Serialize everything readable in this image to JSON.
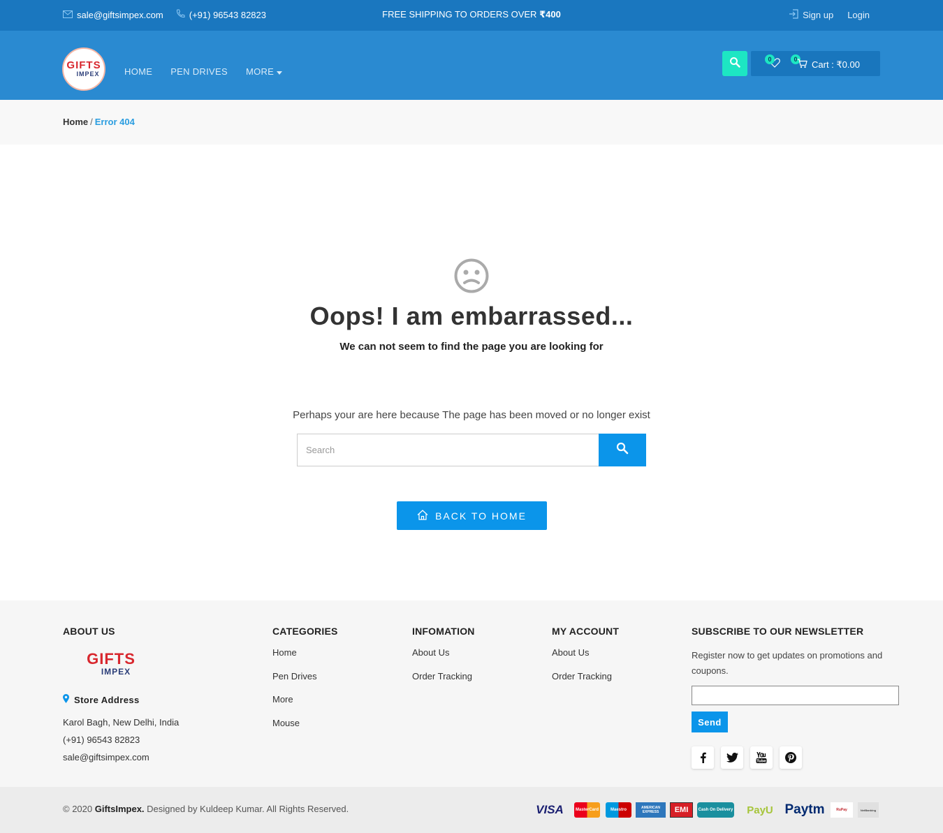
{
  "topbar": {
    "email": "sale@giftsimpex.com",
    "phone": "(+91) 96543 82823",
    "promo_text": "FREE SHIPPING TO ORDERS OVER",
    "promo_amount": "₹400",
    "signup_label": "Sign up",
    "login_label": "Login"
  },
  "header": {
    "logo_line1": "GIFTS",
    "logo_line2": "IMPEX",
    "nav": [
      "HOME",
      "PEN DRIVES",
      "MORE"
    ],
    "wishlist_count": "0",
    "cart_count": "0",
    "cart_label": "Cart : ₹0.00"
  },
  "breadcrumb": {
    "home": "Home",
    "separator": "/",
    "current": "Error 404"
  },
  "main": {
    "title": "Oops! I am embarrassed...",
    "subtitle": "We can not seem to find the page you are looking for",
    "reason": "Perhaps your are here because The page has been moved or no longer exist",
    "search_placeholder": "Search",
    "back_label": "BACK TO HOME"
  },
  "footer": {
    "about": {
      "heading": "ABOUT US",
      "logo_line1": "GIFTS",
      "logo_line2": "IMPEX",
      "store_heading": "Store Address",
      "address": "Karol Bagh, New Delhi, India",
      "phone": "(+91) 96543 82823",
      "email": "sale@giftsimpex.com"
    },
    "categories": {
      "heading": "CATEGORIES",
      "items": [
        "Home",
        "Pen Drives",
        "More",
        "Mouse"
      ]
    },
    "information": {
      "heading": "INFOMATION",
      "items": [
        "About Us",
        "Order Tracking"
      ]
    },
    "account": {
      "heading": "MY ACCOUNT",
      "items": [
        "About Us",
        "Order Tracking"
      ]
    },
    "newsletter": {
      "heading": "SUBSCRIBE TO OUR NEWSLETTER",
      "text": "Register now to get updates on promotions and coupons.",
      "send_label": "Send",
      "socials": [
        "facebook-icon",
        "twitter-icon",
        "youtube-icon",
        "pinterest-icon"
      ]
    }
  },
  "bottom": {
    "copyright_prefix": "© 2020",
    "brand": "GiftsImpex.",
    "copyright_suffix": "Designed by Kuldeep Kumar. All Rights Reserved.",
    "payments": [
      "VISA",
      "MasterCard",
      "Maestro",
      "AMERICAN EXPRESS",
      "EMI",
      "Cash On Delivery",
      "PayU",
      "Paytm",
      "RuPay",
      "NetBanking"
    ]
  },
  "colors": {
    "topbar": "#1a77bf",
    "header": "#2a8ad1",
    "accent": "#0b95ea",
    "search_button": "#1de6c3"
  }
}
